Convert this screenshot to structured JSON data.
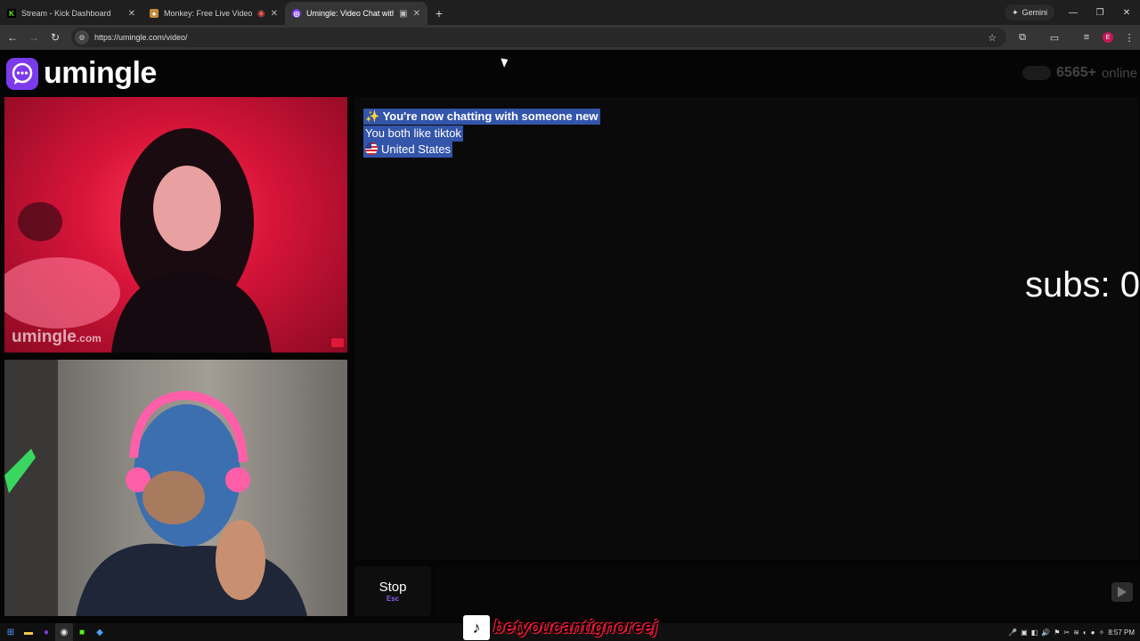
{
  "browser": {
    "tabs": [
      {
        "label": "Stream - Kick Dashboard",
        "favicon": "K",
        "favicon_color": "#53fc18"
      },
      {
        "label": "Monkey: Free Live Video Ch",
        "favicon": "🐵",
        "favicon_color": "#c58a3a"
      },
      {
        "label": "Umingle: Video Chat with S",
        "favicon": "◎",
        "favicon_color": "#7c3aed"
      }
    ],
    "new_tab": "+",
    "gemini_label": "Gemini",
    "url": "https://umingle.com/video/",
    "profile_initial": "E"
  },
  "site": {
    "brand": "umingle",
    "brand_color": "#7c3aed",
    "online_count": "6565+",
    "online_label": "online"
  },
  "video": {
    "watermark_main": "umingle",
    "watermark_suffix": ".com"
  },
  "chat": {
    "messages": [
      {
        "icon": "✨",
        "text": "You're now chatting with someone new"
      },
      {
        "text": "You both like tiktok"
      },
      {
        "flag": "us-flag",
        "text": "United States"
      }
    ]
  },
  "overlay": {
    "subs_text": "subs: 0",
    "tiktok_handle": "betyoucantignoreej"
  },
  "controls": {
    "stop_label": "Stop",
    "stop_shortcut": "Esc"
  },
  "taskbar": {
    "time": "8:57 PM"
  }
}
